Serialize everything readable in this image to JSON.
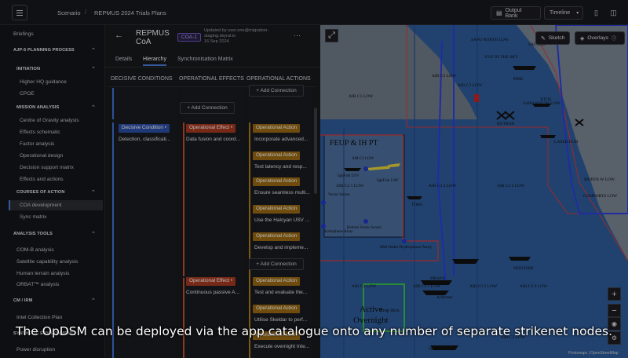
{
  "topbar": {
    "crumb_root": "Scenario",
    "crumb_sep": "/",
    "crumb_current": "REPMUS 2024 Trials Plans",
    "output_bank": "Output Bank",
    "timeline": "Timeline"
  },
  "sidebar": {
    "items": [
      {
        "label": "Briefings",
        "type": "item"
      },
      {
        "label": "AJP-5 PLANNING PROCESS",
        "type": "section"
      },
      {
        "label": "INITIATION",
        "type": "subsection"
      },
      {
        "label": "Higher HQ guidance",
        "type": "item"
      },
      {
        "label": "CPOE",
        "type": "item"
      },
      {
        "label": "MISSION ANALYSIS",
        "type": "subsection"
      },
      {
        "label": "Centre of Gravity analysis",
        "type": "item"
      },
      {
        "label": "Effects schematic",
        "type": "item"
      },
      {
        "label": "Factor analysis",
        "type": "item"
      },
      {
        "label": "Operational design",
        "type": "item"
      },
      {
        "label": "Decision support matrix",
        "type": "item"
      },
      {
        "label": "Effects and actions",
        "type": "item"
      },
      {
        "label": "COURSES OF ACTION",
        "type": "subsection"
      },
      {
        "label": "COA development",
        "type": "active"
      },
      {
        "label": "Sync matrix",
        "type": "item"
      },
      {
        "label": "ANALYSIS TOOLS",
        "type": "section"
      },
      {
        "label": "COM-B analysis",
        "type": "item"
      },
      {
        "label": "Satellite capability analysis",
        "type": "item"
      },
      {
        "label": "Human terrain analysis",
        "type": "item"
      },
      {
        "label": "ORBAT™ analysis",
        "type": "item"
      },
      {
        "label": "CM / IRM",
        "type": "section"
      },
      {
        "label": "Intel Collection Plan",
        "type": "item"
      },
      {
        "label": "SYNTHETIC ENVIRONMENT",
        "type": "section"
      },
      {
        "label": "Power disruption",
        "type": "item"
      }
    ]
  },
  "panel": {
    "title_line1": "REPMUS",
    "title_line2": "CoA",
    "coa_badge": "COA-1",
    "updated_line1": "Updated by user.one@migration-",
    "updated_line2": "staging.skyral.io",
    "updated_date": "16 Sep 2024",
    "more": "···",
    "tabs": [
      "Details",
      "Hierarchy",
      "Synchronisation Matrix"
    ],
    "columns": [
      "DECISIVE CONDITIONS",
      "OPERATIONAL EFFECTS",
      "OPERATIONAL ACTIONS"
    ],
    "add_connection": "+ Add Connection",
    "decisive": {
      "tag": "Decisive Condition",
      "text": "Detection, classificati..."
    },
    "effects": [
      {
        "tag": "Operational Effect",
        "text": "Data fusion and coord..."
      },
      {
        "tag": "Operational Effect",
        "text": "Continuous passive A..."
      }
    ],
    "actions": [
      {
        "tag": "Operational Action",
        "text": "Incorporate advanced..."
      },
      {
        "tag": "Operational Action",
        "text": "Test latency and resp..."
      },
      {
        "tag": "Operational Action",
        "text": "Ensure seamless multi..."
      },
      {
        "tag": "Operational Action",
        "text": "Use the Halcyan USV ..."
      },
      {
        "tag": "Operational Action",
        "text": "Develop and impleme..."
      },
      {
        "tag": "Operational Action",
        "text": "Test and evaluate the..."
      },
      {
        "tag": "Operational Action",
        "text": "Utilise Skeldar to perf..."
      },
      {
        "tag": "Operational Action",
        "text": "Execute overnight Inte..."
      }
    ]
  },
  "map": {
    "sketch": "Sketch",
    "overlays": "Overlays",
    "labels": [
      "SAPO NORTH LOW",
      "EYE IN THE SKY",
      "SALTIES",
      "AIR C3 LOW",
      "PIRK",
      "AIR C3 LOW",
      "SAPO SOUTH LOW",
      "XTOS",
      "ROTRON",
      "AIR C1 LOW",
      "LASER FLM",
      "FEUP & IH PT",
      "lighFish USV",
      "lighFish UAV",
      "AIR C2 LOW",
      "AIR C2 4 LOW",
      "AIR C2 5 LOW",
      "AIR C2 1 LOW",
      "COMPORTS LOW",
      "MURTA W LOW",
      "Vector Sensor",
      "TORS",
      "Bottom Vector Sensor",
      "Hydrophone Array",
      "Mid Water Hydrophone Array",
      "KALEGA",
      "SKELDAR",
      "AIR C3 LOW",
      "AIR C3 1 LOW",
      "AIR C3 5 LOW",
      "AIR C3 6 LOW",
      "PIRAYA",
      "Achernar",
      "Prop Box",
      "Active",
      "Overnight",
      "ORION",
      "AIR C3 LOW",
      "Protomaps",
      "OpenStreetMap"
    ]
  },
  "caption": "The OpDSM can be deployed via the app catalogue onto any number of separate strikenet nodes."
}
